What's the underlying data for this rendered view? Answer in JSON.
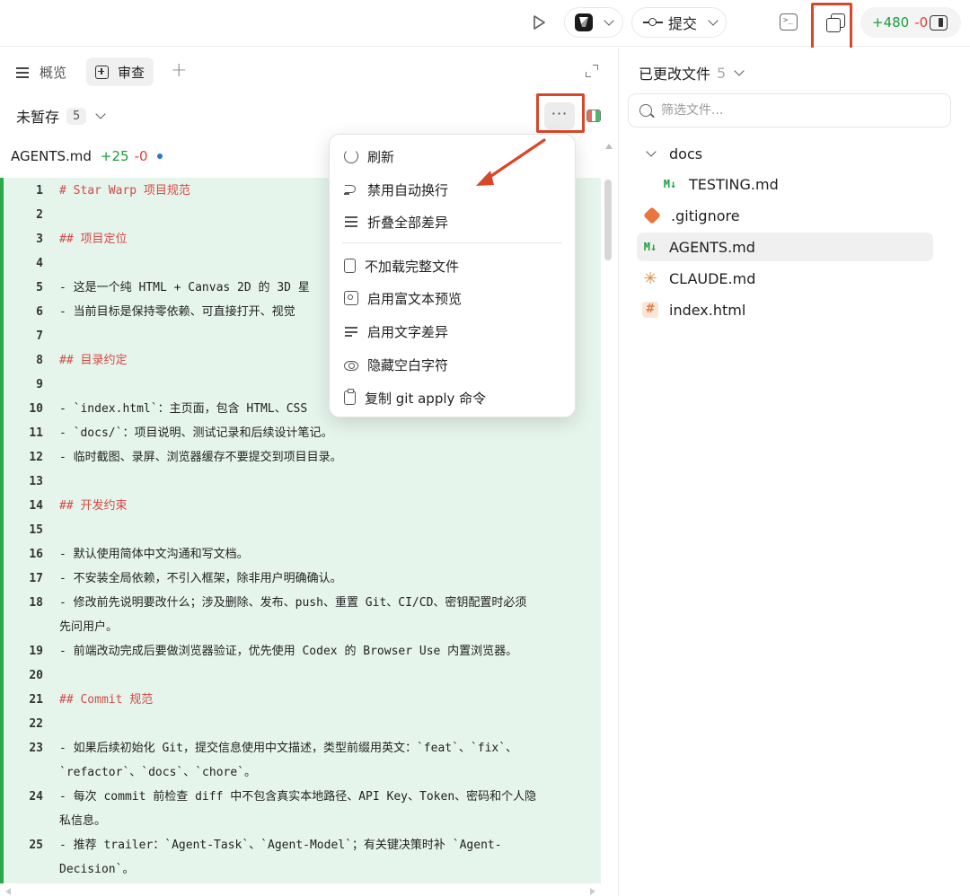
{
  "toolbar": {
    "commit_label": "提交",
    "additions": "+480",
    "deletions": "-0"
  },
  "tabs": {
    "overview": "概览",
    "review": "审查"
  },
  "unstaged": {
    "label": "未暂存",
    "count": "5",
    "more": "···"
  },
  "file": {
    "name": "AGENTS.md",
    "additions": "+25",
    "deletions": "-0"
  },
  "diff_lines": [
    {
      "n": "1",
      "t": "# Star Warp 项目规范",
      "h": true
    },
    {
      "n": "2",
      "t": ""
    },
    {
      "n": "3",
      "t": "## 项目定位",
      "h": true
    },
    {
      "n": "4",
      "t": ""
    },
    {
      "n": "5",
      "t": "- 这是一个纯 HTML + Canvas 2D 的 3D 星"
    },
    {
      "n": "6",
      "t": "- 当前目标是保持零依赖、可直接打开、视觉"
    },
    {
      "n": "7",
      "t": ""
    },
    {
      "n": "8",
      "t": "## 目录约定",
      "h": true
    },
    {
      "n": "9",
      "t": ""
    },
    {
      "n": "10",
      "t": "- `index.html`：主页面，包含 HTML、CSS"
    },
    {
      "n": "11",
      "t": "- `docs/`：项目说明、测试记录和后续设计笔记。"
    },
    {
      "n": "12",
      "t": "- 临时截图、录屏、浏览器缓存不要提交到项目目录。"
    },
    {
      "n": "13",
      "t": ""
    },
    {
      "n": "14",
      "t": "## 开发约束",
      "h": true
    },
    {
      "n": "15",
      "t": ""
    },
    {
      "n": "16",
      "t": "- 默认使用简体中文沟通和写文档。"
    },
    {
      "n": "17",
      "t": "- 不安装全局依赖，不引入框架，除非用户明确确认。"
    },
    {
      "n": "18",
      "t": "- 修改前先说明要改什么；涉及删除、发布、push、重置 Git、CI/CD、密钥配置时必须",
      "c": "先问用户。"
    },
    {
      "n": "19",
      "t": "- 前端改动完成后要做浏览器验证，优先使用 Codex 的 Browser Use 内置浏览器。"
    },
    {
      "n": "20",
      "t": ""
    },
    {
      "n": "21",
      "t": "## Commit 规范",
      "h": true
    },
    {
      "n": "22",
      "t": ""
    },
    {
      "n": "23",
      "t": "- 如果后续初始化 Git，提交信息使用中文描述，类型前缀用英文：`feat`、`fix`、",
      "c": "`refactor`、`docs`、`chore`。"
    },
    {
      "n": "24",
      "t": "- 每次 commit 前检查 diff 中不包含真实本地路径、API Key、Token、密码和个人隐",
      "c": "私信息。"
    },
    {
      "n": "25",
      "t": "- 推荐 trailer：`Agent-Task`、`Agent-Model`；有关键决策时补 `Agent-",
      "c": "Decision`。"
    }
  ],
  "menu": {
    "items": [
      {
        "label": "刷新",
        "icon": "refresh-icon"
      },
      {
        "label": "禁用自动换行",
        "icon": "wrap-icon"
      },
      {
        "label": "折叠全部差异",
        "icon": "fold-icon"
      },
      {
        "label": "不加载完整文件",
        "icon": "file-icon"
      },
      {
        "label": "启用富文本预览",
        "icon": "image-icon"
      },
      {
        "label": "启用文字差异",
        "icon": "text-diff-icon"
      },
      {
        "label": "隐藏空白字符",
        "icon": "eye-icon"
      },
      {
        "label": "复制 git apply 命令",
        "icon": "clipboard-icon"
      }
    ]
  },
  "right": {
    "title": "已更改文件",
    "count": "5",
    "filter_placeholder": "筛选文件...",
    "tree": [
      {
        "label": "docs",
        "type": "folder"
      },
      {
        "label": "TESTING.md",
        "type": "md"
      },
      {
        "label": ".gitignore",
        "type": "git"
      },
      {
        "label": "AGENTS.md",
        "type": "md"
      },
      {
        "label": "CLAUDE.md",
        "type": "claude"
      },
      {
        "label": "index.html",
        "type": "html"
      }
    ]
  },
  "colors": {
    "accent_red": "#d9472b",
    "addition": "#1a9d3c",
    "deletion": "#e0413a",
    "diff_bg": "#e6f5ec"
  }
}
